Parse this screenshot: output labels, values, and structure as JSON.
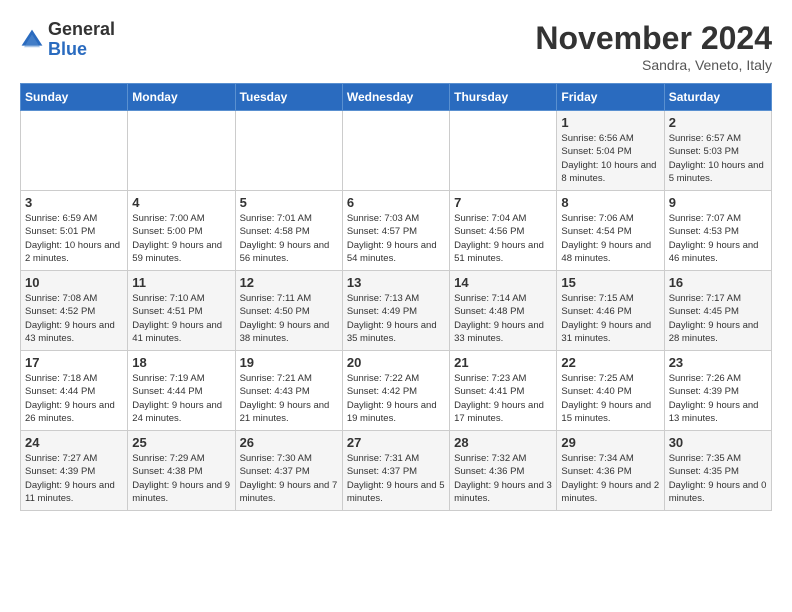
{
  "logo": {
    "general": "General",
    "blue": "Blue"
  },
  "title": "November 2024",
  "subtitle": "Sandra, Veneto, Italy",
  "headers": [
    "Sunday",
    "Monday",
    "Tuesday",
    "Wednesday",
    "Thursday",
    "Friday",
    "Saturday"
  ],
  "weeks": [
    [
      {
        "day": "",
        "info": ""
      },
      {
        "day": "",
        "info": ""
      },
      {
        "day": "",
        "info": ""
      },
      {
        "day": "",
        "info": ""
      },
      {
        "day": "",
        "info": ""
      },
      {
        "day": "1",
        "info": "Sunrise: 6:56 AM\nSunset: 5:04 PM\nDaylight: 10 hours and 8 minutes."
      },
      {
        "day": "2",
        "info": "Sunrise: 6:57 AM\nSunset: 5:03 PM\nDaylight: 10 hours and 5 minutes."
      }
    ],
    [
      {
        "day": "3",
        "info": "Sunrise: 6:59 AM\nSunset: 5:01 PM\nDaylight: 10 hours and 2 minutes."
      },
      {
        "day": "4",
        "info": "Sunrise: 7:00 AM\nSunset: 5:00 PM\nDaylight: 9 hours and 59 minutes."
      },
      {
        "day": "5",
        "info": "Sunrise: 7:01 AM\nSunset: 4:58 PM\nDaylight: 9 hours and 56 minutes."
      },
      {
        "day": "6",
        "info": "Sunrise: 7:03 AM\nSunset: 4:57 PM\nDaylight: 9 hours and 54 minutes."
      },
      {
        "day": "7",
        "info": "Sunrise: 7:04 AM\nSunset: 4:56 PM\nDaylight: 9 hours and 51 minutes."
      },
      {
        "day": "8",
        "info": "Sunrise: 7:06 AM\nSunset: 4:54 PM\nDaylight: 9 hours and 48 minutes."
      },
      {
        "day": "9",
        "info": "Sunrise: 7:07 AM\nSunset: 4:53 PM\nDaylight: 9 hours and 46 minutes."
      }
    ],
    [
      {
        "day": "10",
        "info": "Sunrise: 7:08 AM\nSunset: 4:52 PM\nDaylight: 9 hours and 43 minutes."
      },
      {
        "day": "11",
        "info": "Sunrise: 7:10 AM\nSunset: 4:51 PM\nDaylight: 9 hours and 41 minutes."
      },
      {
        "day": "12",
        "info": "Sunrise: 7:11 AM\nSunset: 4:50 PM\nDaylight: 9 hours and 38 minutes."
      },
      {
        "day": "13",
        "info": "Sunrise: 7:13 AM\nSunset: 4:49 PM\nDaylight: 9 hours and 35 minutes."
      },
      {
        "day": "14",
        "info": "Sunrise: 7:14 AM\nSunset: 4:48 PM\nDaylight: 9 hours and 33 minutes."
      },
      {
        "day": "15",
        "info": "Sunrise: 7:15 AM\nSunset: 4:46 PM\nDaylight: 9 hours and 31 minutes."
      },
      {
        "day": "16",
        "info": "Sunrise: 7:17 AM\nSunset: 4:45 PM\nDaylight: 9 hours and 28 minutes."
      }
    ],
    [
      {
        "day": "17",
        "info": "Sunrise: 7:18 AM\nSunset: 4:44 PM\nDaylight: 9 hours and 26 minutes."
      },
      {
        "day": "18",
        "info": "Sunrise: 7:19 AM\nSunset: 4:44 PM\nDaylight: 9 hours and 24 minutes."
      },
      {
        "day": "19",
        "info": "Sunrise: 7:21 AM\nSunset: 4:43 PM\nDaylight: 9 hours and 21 minutes."
      },
      {
        "day": "20",
        "info": "Sunrise: 7:22 AM\nSunset: 4:42 PM\nDaylight: 9 hours and 19 minutes."
      },
      {
        "day": "21",
        "info": "Sunrise: 7:23 AM\nSunset: 4:41 PM\nDaylight: 9 hours and 17 minutes."
      },
      {
        "day": "22",
        "info": "Sunrise: 7:25 AM\nSunset: 4:40 PM\nDaylight: 9 hours and 15 minutes."
      },
      {
        "day": "23",
        "info": "Sunrise: 7:26 AM\nSunset: 4:39 PM\nDaylight: 9 hours and 13 minutes."
      }
    ],
    [
      {
        "day": "24",
        "info": "Sunrise: 7:27 AM\nSunset: 4:39 PM\nDaylight: 9 hours and 11 minutes."
      },
      {
        "day": "25",
        "info": "Sunrise: 7:29 AM\nSunset: 4:38 PM\nDaylight: 9 hours and 9 minutes."
      },
      {
        "day": "26",
        "info": "Sunrise: 7:30 AM\nSunset: 4:37 PM\nDaylight: 9 hours and 7 minutes."
      },
      {
        "day": "27",
        "info": "Sunrise: 7:31 AM\nSunset: 4:37 PM\nDaylight: 9 hours and 5 minutes."
      },
      {
        "day": "28",
        "info": "Sunrise: 7:32 AM\nSunset: 4:36 PM\nDaylight: 9 hours and 3 minutes."
      },
      {
        "day": "29",
        "info": "Sunrise: 7:34 AM\nSunset: 4:36 PM\nDaylight: 9 hours and 2 minutes."
      },
      {
        "day": "30",
        "info": "Sunrise: 7:35 AM\nSunset: 4:35 PM\nDaylight: 9 hours and 0 minutes."
      }
    ]
  ]
}
